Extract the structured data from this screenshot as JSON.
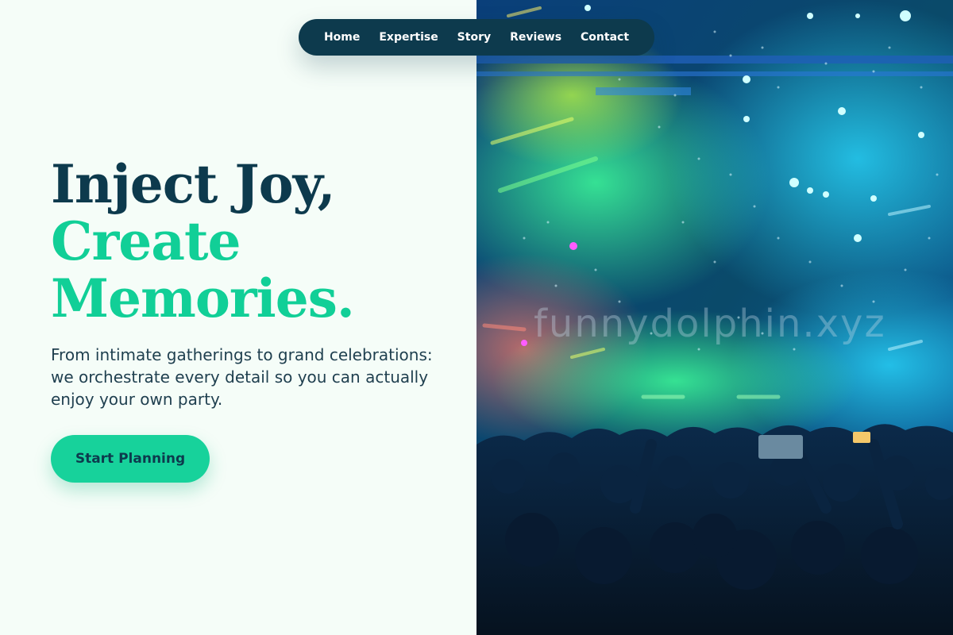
{
  "nav": {
    "items": [
      {
        "label": "Home"
      },
      {
        "label": "Expertise"
      },
      {
        "label": "Story"
      },
      {
        "label": "Reviews"
      },
      {
        "label": "Contact"
      }
    ]
  },
  "hero": {
    "title_line1": "Inject Joy,",
    "title_line2": "Create",
    "title_line3": "Memories.",
    "subtitle": "From intimate gatherings to grand celebrations: we orchestrate every detail so you can actually enjoy your own party.",
    "cta_label": "Start Planning"
  },
  "image": {
    "watermark": "funnydolphin.xyz"
  },
  "colors": {
    "background": "#f5fdf8",
    "navy": "#0d3a4d",
    "accent": "#11cf97",
    "button": "#17d29b"
  }
}
